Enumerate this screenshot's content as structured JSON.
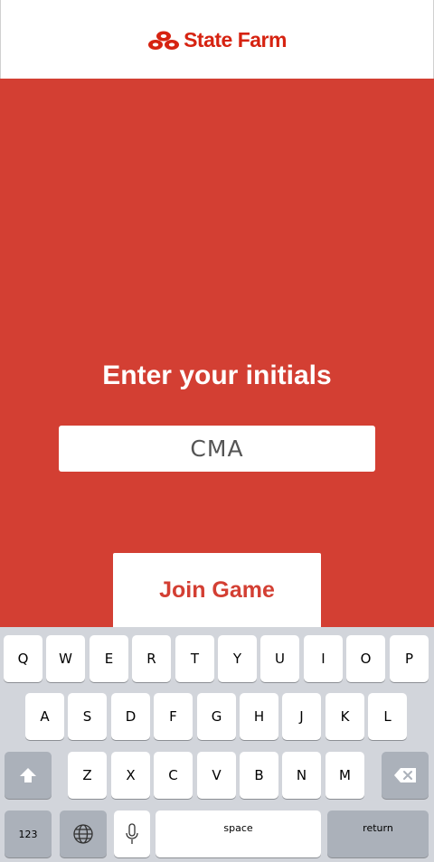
{
  "header": {
    "brand": "State Farm"
  },
  "main": {
    "prompt": "Enter your initials",
    "initials_value": "CMA",
    "join_label": "Join Game"
  },
  "keyboard": {
    "row1": [
      "Q",
      "W",
      "E",
      "R",
      "T",
      "Y",
      "U",
      "I",
      "O",
      "P"
    ],
    "row2": [
      "A",
      "S",
      "D",
      "F",
      "G",
      "H",
      "J",
      "K",
      "L"
    ],
    "row3": [
      "Z",
      "X",
      "C",
      "V",
      "B",
      "N",
      "M"
    ],
    "numbers_label": "123",
    "space_label": "space",
    "return_label": "return",
    "icons": [
      "shift-icon",
      "backspace-icon",
      "globe-icon",
      "microphone-icon"
    ]
  },
  "colors": {
    "brand": "#d62311",
    "main_bg": "#d33f33",
    "keyboard_bg": "#d2d5db"
  }
}
